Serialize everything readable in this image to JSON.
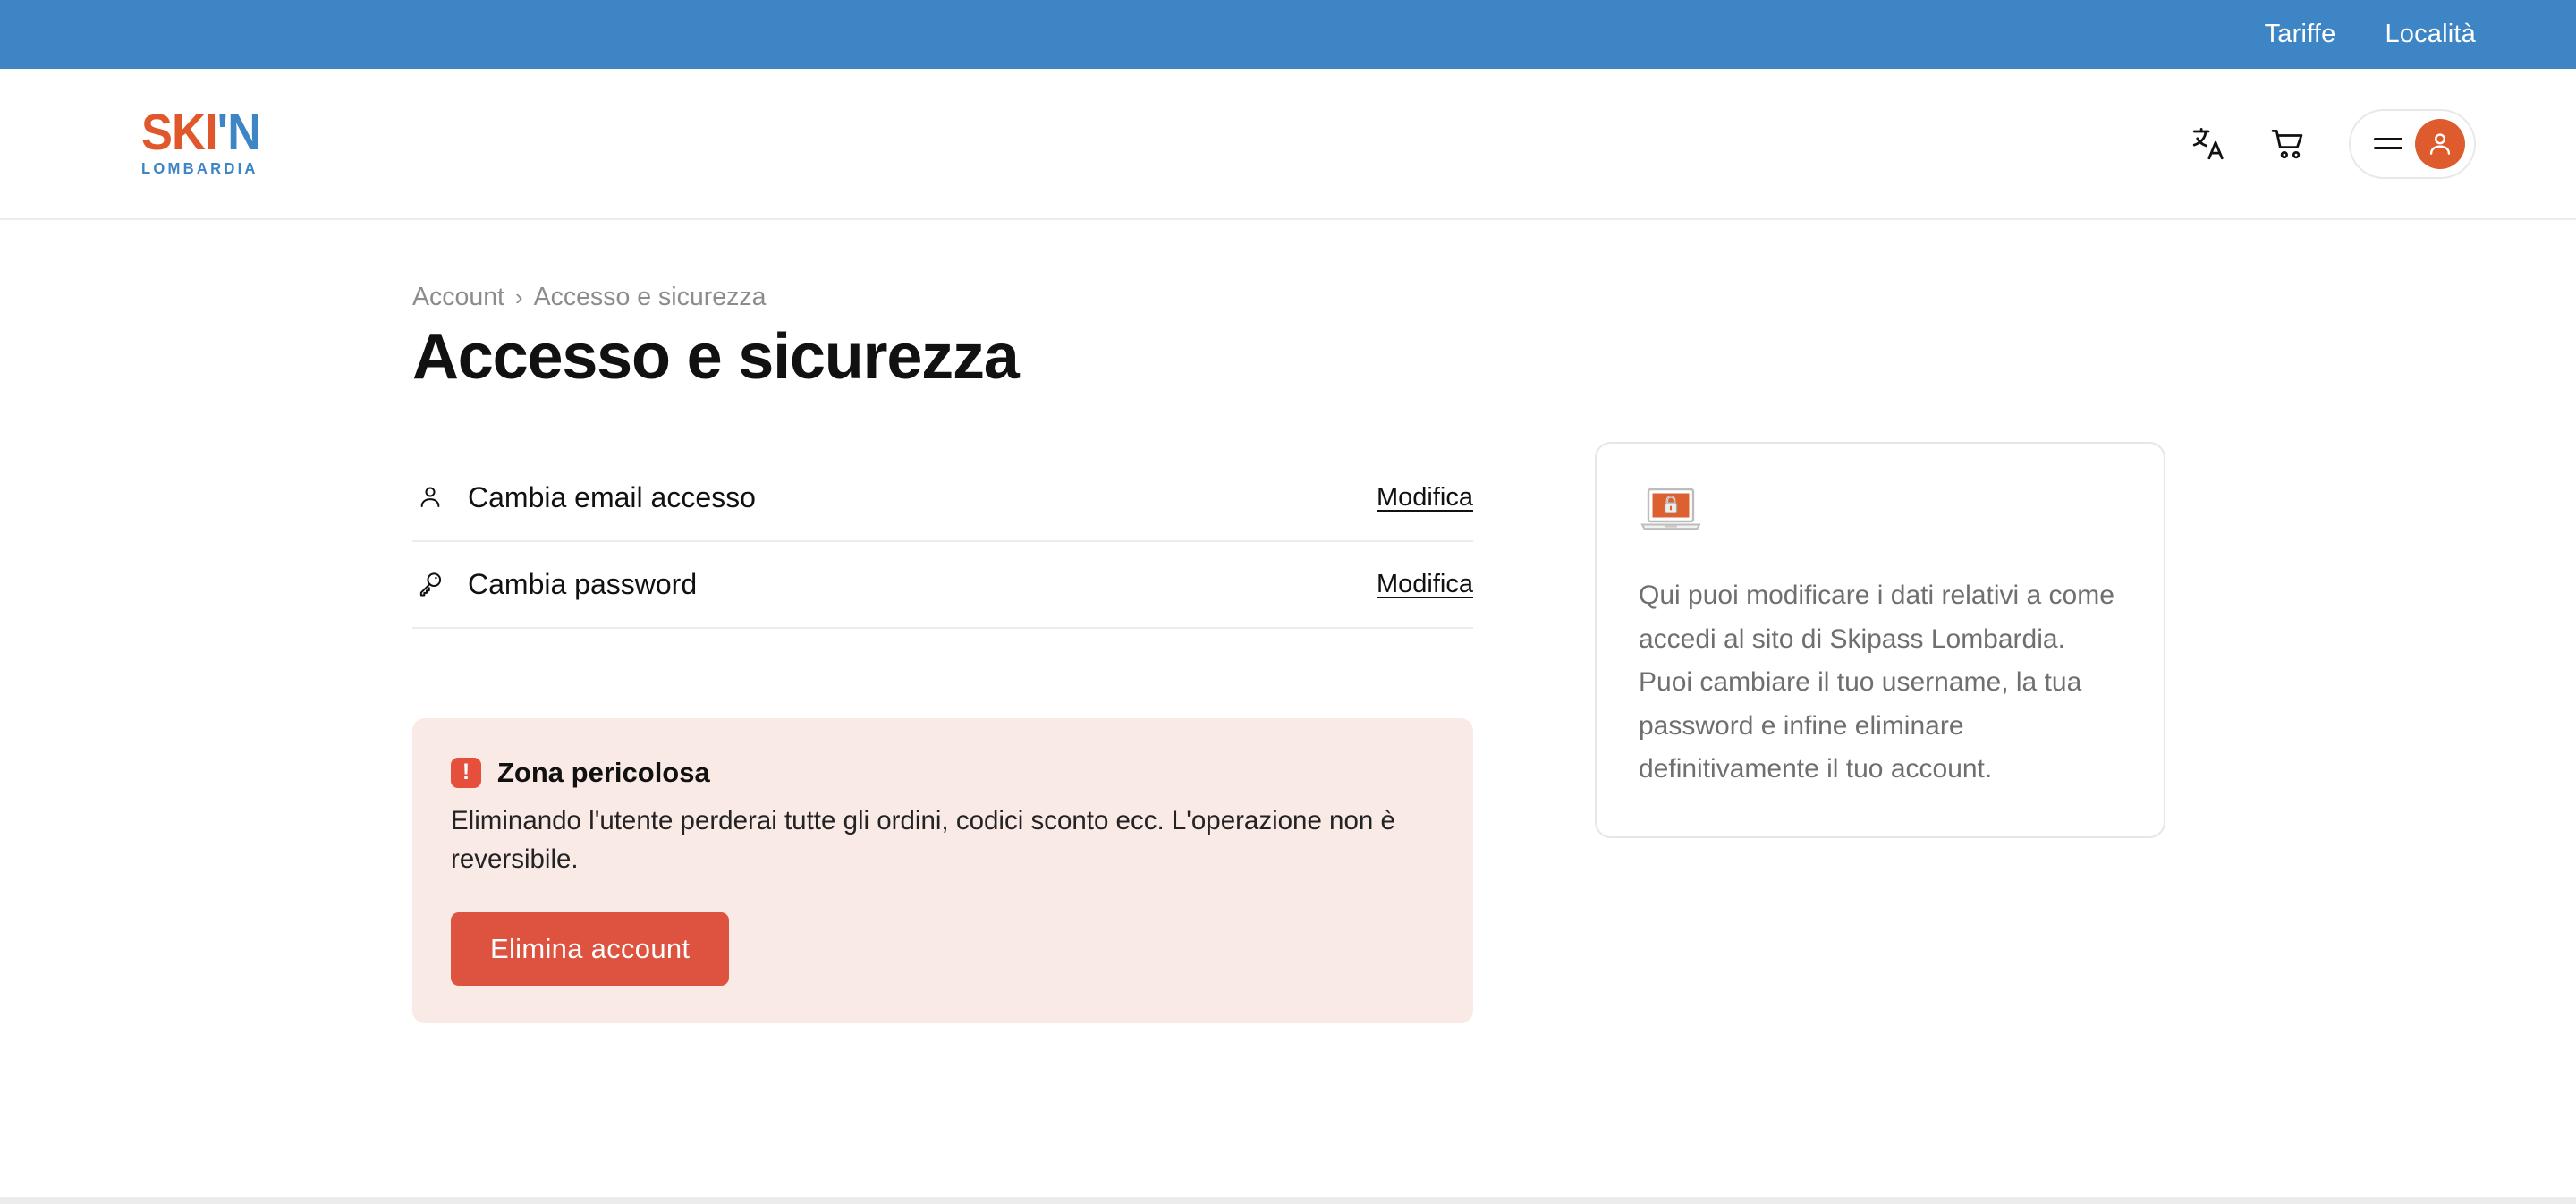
{
  "topbar": {
    "links": [
      {
        "label": "Tariffe"
      },
      {
        "label": "Località"
      }
    ]
  },
  "header": {
    "logo": {
      "primary": "SKI",
      "accent": "'N",
      "subtitle": "LOMBARDIA"
    },
    "icons": {
      "translate": "translate-icon",
      "cart": "cart-icon",
      "menu": "hamburger-icon",
      "avatar": "user-avatar-icon"
    }
  },
  "breadcrumb": {
    "parent": "Account",
    "separator": "›",
    "current": "Accesso e sicurezza"
  },
  "main": {
    "title": "Accesso e sicurezza",
    "settings": [
      {
        "icon": "user-icon",
        "label": "Cambia email accesso",
        "action": "Modifica"
      },
      {
        "icon": "key-icon",
        "label": "Cambia password",
        "action": "Modifica"
      }
    ],
    "danger": {
      "badge": "!",
      "title": "Zona pericolosa",
      "description": "Eliminando l'utente perderai tutte gli ordini, codici sconto ecc. L'operazione non è reversibile.",
      "button": "Elimina account"
    }
  },
  "side": {
    "icon": "laptop-lock-icon",
    "text": "Qui puoi modificare i dati relativi a come accedi al sito di Skipass Lombardia. Puoi cambiare il tuo username, la tua password e infine eliminare definitivamente il tuo account."
  },
  "colors": {
    "topbar_blue": "#3d85c4",
    "brand_orange": "#e0572b",
    "avatar_orange": "#dd5b2d",
    "danger_bg": "#faeae6",
    "danger_button": "#dd5340",
    "danger_badge": "#e5503c"
  }
}
